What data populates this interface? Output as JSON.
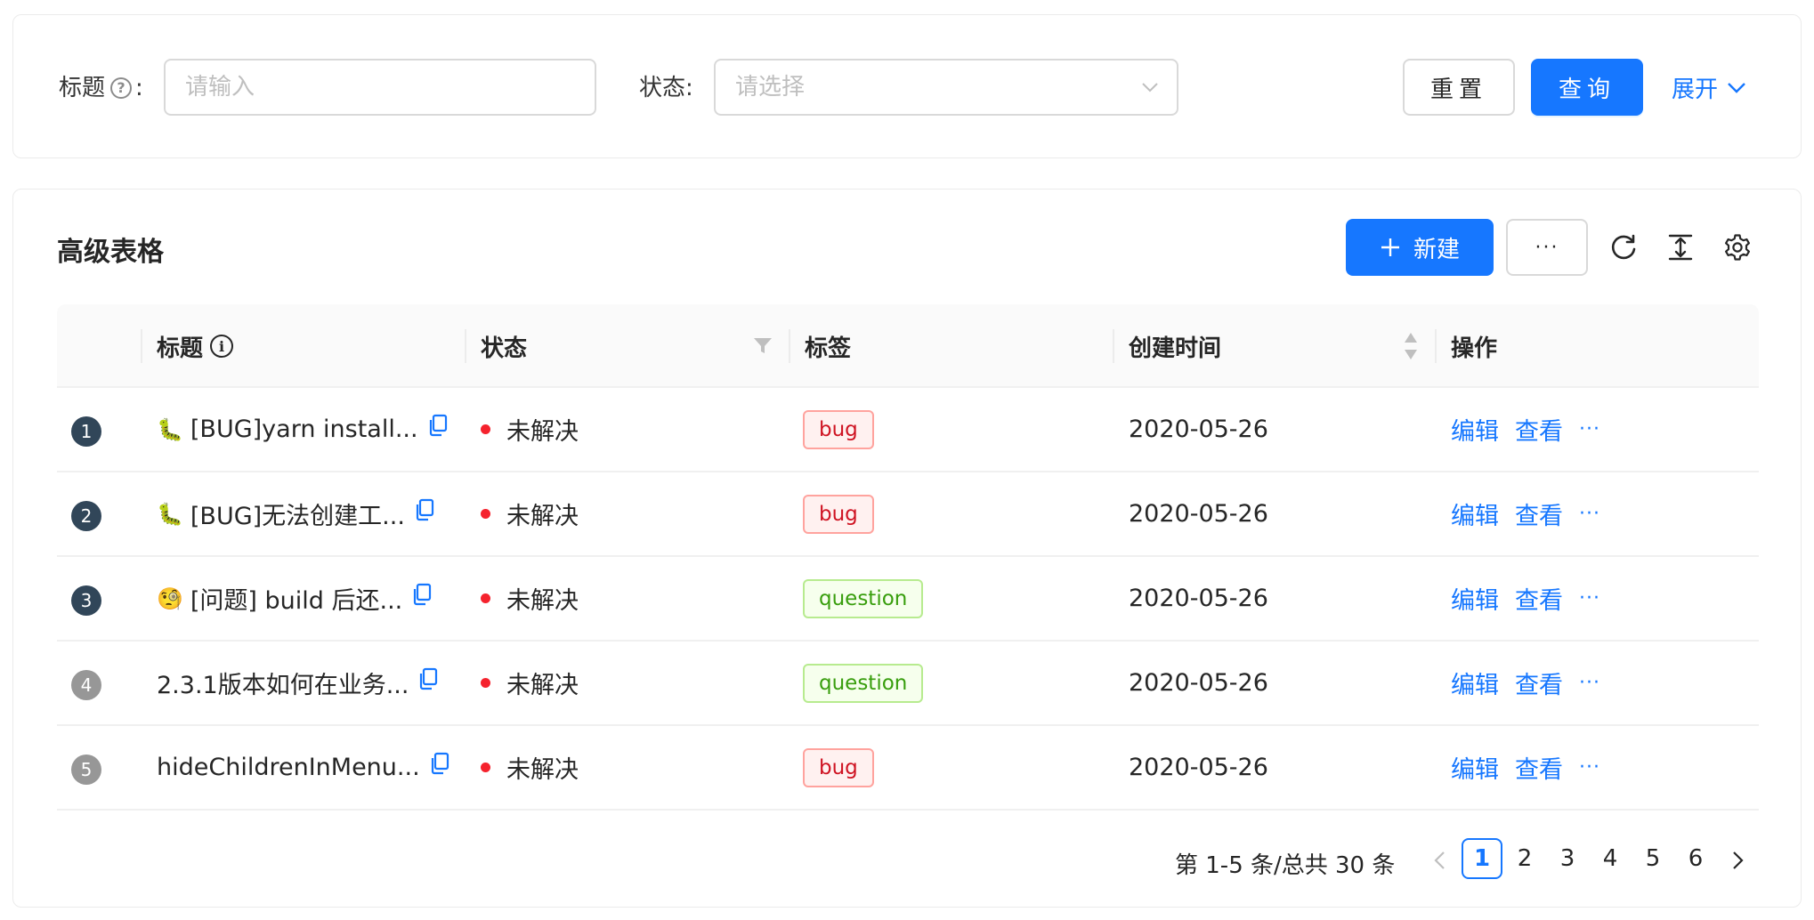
{
  "search": {
    "title_label": "标题",
    "title_colon": ":",
    "title_placeholder": "请输入",
    "status_label": "状态:",
    "status_placeholder": "请选择",
    "reset_label": "重置",
    "query_label": "查询",
    "expand_label": "展开"
  },
  "table_card": {
    "title": "高级表格",
    "new_label": "新建",
    "more_label": "···"
  },
  "columns": [
    "标题",
    "状态",
    "标签",
    "创建时间",
    "操作"
  ],
  "rows": [
    {
      "index": "1",
      "emoji": "🐛",
      "title": "[BUG]yarn install...",
      "status": "未解决",
      "tag": "bug",
      "date": "2020-05-26",
      "edit": "编辑",
      "view": "查看",
      "more": "···"
    },
    {
      "index": "2",
      "emoji": "🐛",
      "title": "[BUG]无法创建工...",
      "status": "未解决",
      "tag": "bug",
      "date": "2020-05-26",
      "edit": "编辑",
      "view": "查看",
      "more": "···"
    },
    {
      "index": "3",
      "emoji": "🧐",
      "title": "[问题] build 后还...",
      "status": "未解决",
      "tag": "question",
      "date": "2020-05-26",
      "edit": "编辑",
      "view": "查看",
      "more": "···"
    },
    {
      "index": "4",
      "emoji": "",
      "title": "2.3.1版本如何在业务...",
      "status": "未解决",
      "tag": "question",
      "date": "2020-05-26",
      "edit": "编辑",
      "view": "查看",
      "more": "···"
    },
    {
      "index": "5",
      "emoji": "",
      "title": "hideChildrenInMenu...",
      "status": "未解决",
      "tag": "bug",
      "date": "2020-05-26",
      "edit": "编辑",
      "view": "查看",
      "more": "···"
    }
  ],
  "pagination": {
    "total_text": "第 1-5 条/总共 30 条",
    "pages": [
      "1",
      "2",
      "3",
      "4",
      "5",
      "6"
    ],
    "current": "1"
  },
  "colors": {
    "primary": "#1677ff",
    "status_dot": "#f5222d",
    "bug_tag": "#cf1322",
    "question_tag": "#389e0d"
  }
}
